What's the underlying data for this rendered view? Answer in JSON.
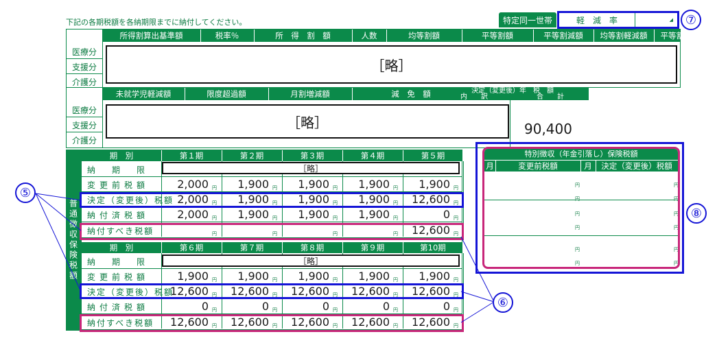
{
  "instruction": "下記の各期税額を各納期限までに納付してください。",
  "tokutei_label": "特定同一世帯",
  "keigen_label": "軽　減　率",
  "top_headers": [
    "所得割算出基準額",
    "税率％",
    "所　得　割　額",
    "人数",
    "均等割額",
    "平等割額",
    "平等割減額",
    "均等割軽減額",
    "平等割軽減額"
  ],
  "mid_headers": [
    "未就学児軽減額",
    "限度超過額",
    "月割増減額",
    "減　免　額"
  ],
  "kettei_title": "決定（変更後）年　税　額",
  "uchiwake": "内　　訳",
  "goukei": "合　　計",
  "row_labels": [
    "医療分",
    "支援分",
    "介護分"
  ],
  "redacted": "［略］",
  "total": "90,400",
  "futsu_label": "普通徴収保険税額",
  "kibetsu": "期　別",
  "periods_a": [
    "第１期",
    "第２期",
    "第３期",
    "第４期",
    "第５期"
  ],
  "periods_b": [
    "第６期",
    "第７期",
    "第８期",
    "第９期",
    "第10期"
  ],
  "rows": [
    "納　期　限",
    "変更前税額",
    "決定（変更後）税額",
    "納付済税額",
    "納付すべき税額"
  ],
  "rows_b": [
    "納　期　限",
    "変更前税額",
    "決定（変更後）税額",
    "納付済税額",
    "納付すべき税額"
  ],
  "block_a": {
    "henkoumae": [
      "2,000",
      "1,900",
      "1,900",
      "1,900",
      "1,900"
    ],
    "kettei": [
      "2,000",
      "1,900",
      "1,900",
      "1,900",
      "12,600"
    ],
    "nofuzumi": [
      "2,000",
      "1,900",
      "1,900",
      "1,900",
      "0"
    ],
    "nofusubeki": [
      "",
      "",
      "",
      "",
      "12,600"
    ]
  },
  "block_b": {
    "henkoumae": [
      "1,900",
      "1,900",
      "1,900",
      "1,900",
      "1,900"
    ],
    "kettei": [
      "12,600",
      "12,600",
      "12,600",
      "12,600",
      "12,600"
    ],
    "nofuzumi": [
      "0",
      "0",
      "0",
      "0",
      "0"
    ],
    "nofusubeki": [
      "12,600",
      "12,600",
      "12,600",
      "12,600",
      "12,600"
    ]
  },
  "yen": "円",
  "tokubetsu_title": "特別徴収（年金引落し）保険税額",
  "tokubetsu_cols": [
    "月",
    "変更前税額",
    "月",
    "決定（変更後）税額"
  ],
  "markers": [
    "⑤",
    "⑥",
    "⑦",
    "⑧"
  ]
}
